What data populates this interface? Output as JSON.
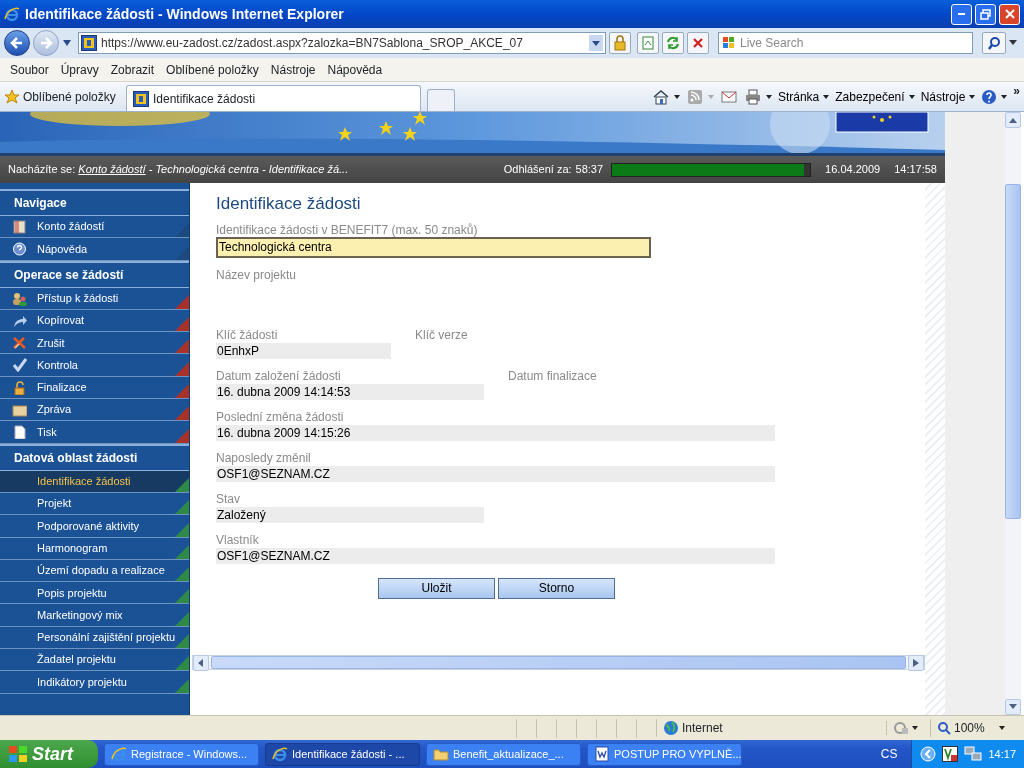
{
  "window": {
    "title": "Identifikace žádosti - Windows Internet Explorer"
  },
  "address_bar": {
    "url": "https://www.eu-zadost.cz/zadost.aspx?zalozka=BN7Sablona_SROP_AKCE_07",
    "search_placeholder": "Live Search"
  },
  "menu": [
    "Soubor",
    "Úpravy",
    "Zobrazit",
    "Oblíbené položky",
    "Nástroje",
    "Nápověda"
  ],
  "favorites_bar": {
    "favorites": "Oblíbené položky",
    "tabs": [
      {
        "label": "Identifikace žádosti",
        "selected": true
      }
    ],
    "commands": [
      "Stránka",
      "Zabezpečení",
      "Nástroje"
    ],
    "more": "»"
  },
  "header": {
    "location_label": "Nacházíte se:",
    "location_link": "Konto žádostí",
    "location_rest": " - Technologická centra - Identifikace žá...",
    "logout_label": "Odhlášení za:",
    "logout_time": "58:37",
    "level": 0.97,
    "date": "16.04.2009",
    "time": "14:17:58"
  },
  "sidebar": [
    {
      "title": "Navigace",
      "color": "#1d4a7e",
      "items": [
        {
          "label": "Konto žádostí",
          "kind": "book",
          "selected": false
        },
        {
          "label": "Nápověda",
          "kind": "help",
          "selected": false
        }
      ]
    },
    {
      "title": "Operace se žádostí",
      "color": "#a8322a",
      "items": [
        {
          "label": "Přístup k žádosti",
          "kind": "people",
          "selected": false
        },
        {
          "label": "Kopírovat",
          "kind": "arrow",
          "selected": false
        },
        {
          "label": "Zrušit",
          "kind": "cross",
          "selected": false
        },
        {
          "label": "Kontrola",
          "kind": "check",
          "selected": false
        },
        {
          "label": "Finalizace",
          "kind": "lock",
          "selected": false
        },
        {
          "label": "Zpráva",
          "kind": "envelope",
          "selected": false
        },
        {
          "label": "Tisk",
          "kind": "page",
          "selected": false
        }
      ]
    },
    {
      "title": "Datová oblast žádosti",
      "color": "#2f8a48",
      "items": [
        {
          "label": "Identifikace žádosti",
          "selected": true
        },
        {
          "label": "Projekt",
          "selected": false
        },
        {
          "label": "Podporované aktivity",
          "selected": false
        },
        {
          "label": "Harmonogram",
          "selected": false
        },
        {
          "label": "Území dopadu a realizace",
          "selected": false
        },
        {
          "label": "Popis projektu",
          "selected": false
        },
        {
          "label": "Marketingový mix",
          "selected": false
        },
        {
          "label": "Personální zajištění projektu",
          "selected": false
        },
        {
          "label": "Žadatel projektu",
          "selected": false
        },
        {
          "label": "Indikátory projektu",
          "selected": false
        }
      ]
    }
  ],
  "form": {
    "title": "Identifikace žádosti",
    "input": {
      "label": "Identifikace žádosti v BENEFIT7 (max. 50 znaků)",
      "value": "Technologická centra"
    },
    "rows": [
      {
        "fields": [
          {
            "label": "Název projektu",
            "kind": "tall"
          }
        ]
      },
      {
        "fields": [
          {
            "label": "Klíč žádosti",
            "value": "0EnhxP",
            "kind": "short"
          },
          {
            "label": "Klíč verze",
            "kind": "short"
          }
        ]
      },
      {
        "fields": [
          {
            "label": "Datum založení žádosti",
            "value": "16. dubna 2009 14:14:53",
            "kind": "medium"
          },
          {
            "label": "Datum finalizace",
            "kind": "short"
          }
        ]
      },
      {
        "fields": [
          {
            "label": "Poslední změna žádosti",
            "value": "16. dubna 2009 14:15:26",
            "kind": "long"
          }
        ]
      },
      {
        "fields": [
          {
            "label": "Naposledy změnil",
            "value": "OSF1@SEZNAM.CZ",
            "kind": "long"
          }
        ]
      },
      {
        "fields": [
          {
            "label": "Stav",
            "value": "Založený",
            "kind": "medium"
          }
        ]
      },
      {
        "fields": [
          {
            "label": "Vlastník",
            "value": "OSF1@SEZNAM.CZ",
            "kind": "long"
          }
        ]
      }
    ],
    "buttons": [
      "Uložit",
      "Storno"
    ]
  },
  "status_bar": {
    "zone": "Internet",
    "zoom": "100%"
  },
  "taskbar": {
    "start": "Start",
    "tasks": [
      {
        "label": "Registrace - Windows...",
        "kind": "ie",
        "selected": false
      },
      {
        "label": "Identifikace žádosti - ...",
        "kind": "ie",
        "selected": true
      },
      {
        "label": "Benefit_aktualizace_...",
        "kind": "folder",
        "selected": false
      },
      {
        "label": "POSTUP PRO VYPLNĚ...",
        "kind": "word",
        "selected": false
      }
    ],
    "language": "CS",
    "clock": "14:17"
  }
}
